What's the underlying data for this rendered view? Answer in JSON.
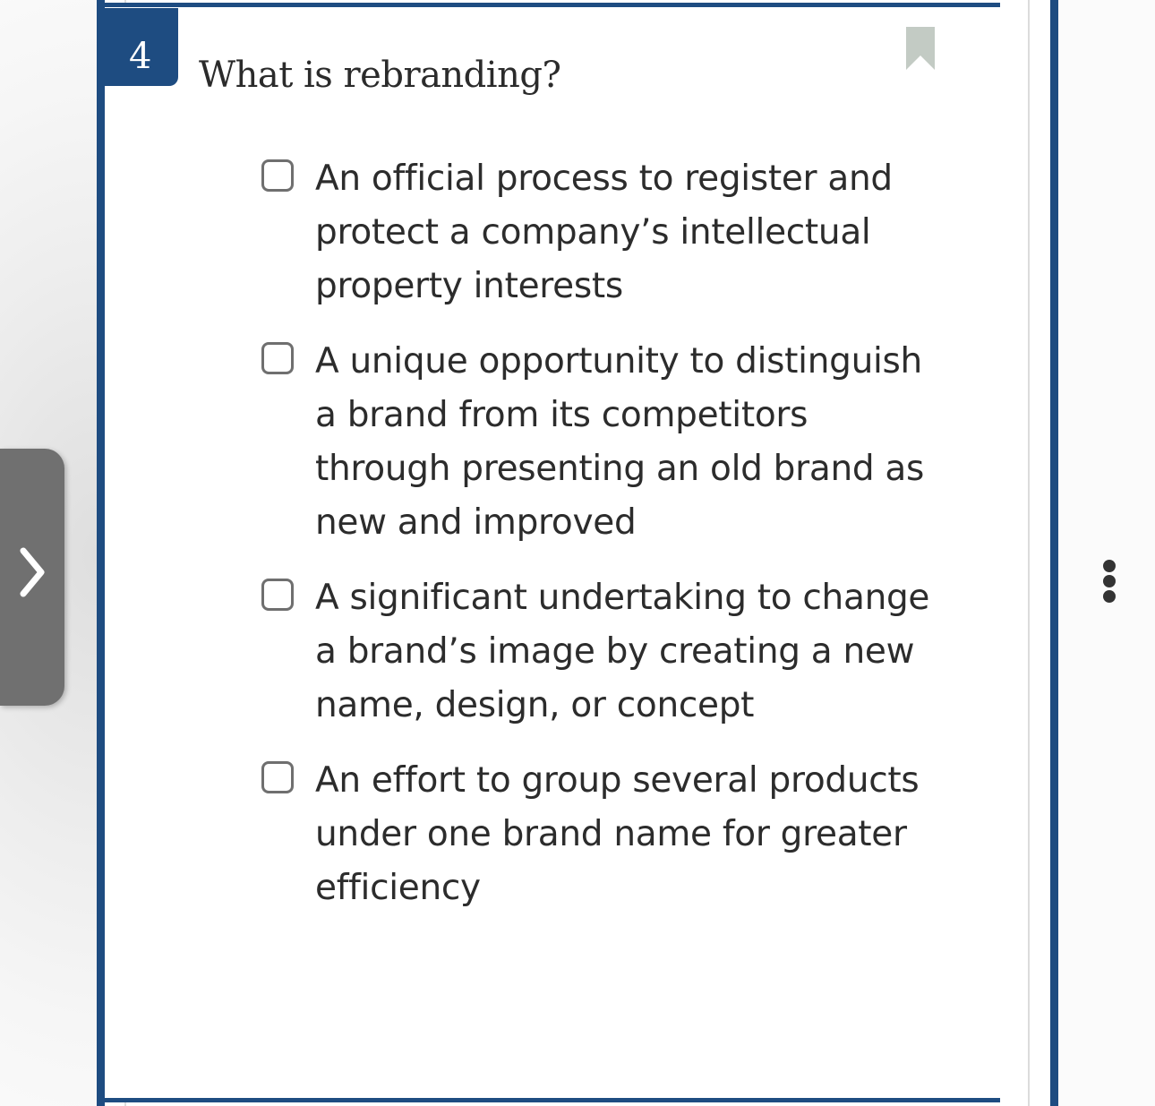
{
  "question": {
    "number": "4",
    "title": "What is rebranding?"
  },
  "options": [
    {
      "label": "An official process to register and protect a company’s intellectual property interests"
    },
    {
      "label": "A unique opportunity to distinguish a brand from its competitors through presenting an old brand as new and improved"
    },
    {
      "label": "A significant undertaking to change a brand’s image by creating a new name, design, or concept"
    },
    {
      "label": "An effort to group several products under one brand name for greater efficiency"
    }
  ],
  "icons": {
    "bookmark": "bookmark-icon",
    "side_nav": "chevron-right-icon",
    "menu": "more-vertical-icon"
  },
  "colors": {
    "accent": "#1e4c81",
    "bookmark": "#c3cbc4",
    "side_tab": "#707070",
    "text": "#2c2c2c"
  }
}
